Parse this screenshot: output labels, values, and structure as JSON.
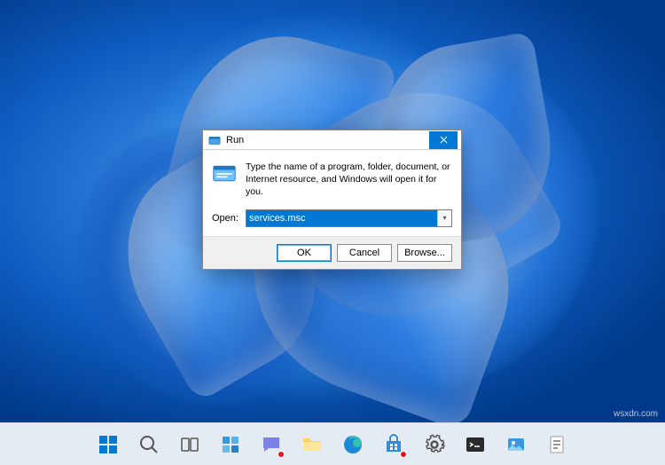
{
  "watermark": "wsxdn.com",
  "run_dialog": {
    "title": "Run",
    "description": "Type the name of a program, folder, document, or Internet resource, and Windows will open it for you.",
    "open_label": "Open:",
    "open_value": "services.msc",
    "buttons": {
      "ok": "OK",
      "cancel": "Cancel",
      "browse": "Browse..."
    }
  },
  "taskbar": {
    "items": [
      {
        "name": "start",
        "icon": "windows-logo-icon"
      },
      {
        "name": "search",
        "icon": "search-icon"
      },
      {
        "name": "task-view",
        "icon": "task-view-icon"
      },
      {
        "name": "widgets",
        "icon": "widgets-icon"
      },
      {
        "name": "chat",
        "icon": "chat-icon",
        "badge": true
      },
      {
        "name": "file-explorer",
        "icon": "file-explorer-icon"
      },
      {
        "name": "edge",
        "icon": "edge-icon"
      },
      {
        "name": "store",
        "icon": "store-icon",
        "badge": true
      },
      {
        "name": "settings",
        "icon": "settings-icon"
      },
      {
        "name": "app-terminal",
        "icon": "terminal-icon"
      },
      {
        "name": "app-photos",
        "icon": "photos-icon"
      },
      {
        "name": "app-notion",
        "icon": "document-icon"
      }
    ]
  },
  "colors": {
    "accent": "#0078d4",
    "taskbar_bg": "rgba(248,248,250,0.92)",
    "dialog_bg": "#f0f0f0"
  }
}
